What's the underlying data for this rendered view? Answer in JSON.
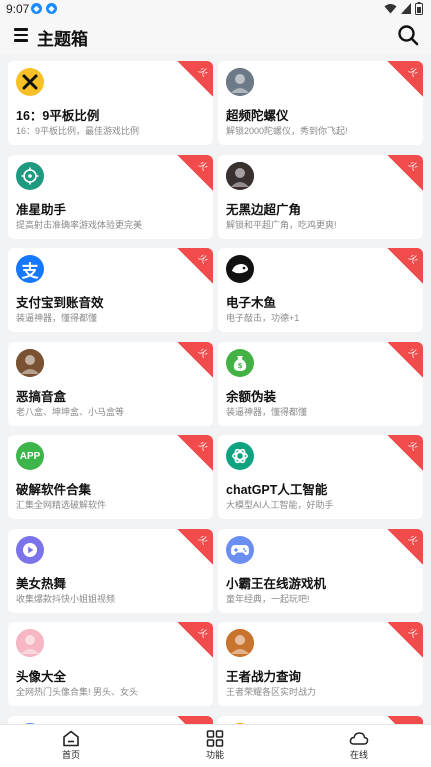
{
  "status": {
    "time": "9:07"
  },
  "header": {
    "title": "主题箱"
  },
  "cards": [
    {
      "name": "16：9平板比例",
      "desc": "16：9平板比例，最佳游戏比例",
      "icon": "hammer-icon",
      "badge": "火",
      "color": "#f6c026"
    },
    {
      "name": "超频陀螺仪",
      "desc": "解锁2000陀螺仪，秀到你飞起!",
      "icon": "player-avatar-icon",
      "badge": "火",
      "color": "#6b7a86"
    },
    {
      "name": "准星助手",
      "desc": "提高射击准确率游戏体验更完美",
      "icon": "crosshair-icon",
      "badge": "火",
      "color": "#1d9a7f"
    },
    {
      "name": "无黑边超广角",
      "desc": "解锁和平超广角，吃鸡更爽!",
      "icon": "helmet-avatar-icon",
      "badge": "火",
      "color": "#3a3030"
    },
    {
      "name": "支付宝到账音效",
      "desc": "装逼神器，懂得都懂",
      "icon": "alipay-icon",
      "badge": "火",
      "color": "#1677ff"
    },
    {
      "name": "电子木鱼",
      "desc": "电子敲击，功德+1",
      "icon": "wooden-fish-icon",
      "badge": "火",
      "color": "#111111"
    },
    {
      "name": "恶搞音盒",
      "desc": "老八盒、坤坤盒、小马盒等",
      "icon": "man-avatar-icon",
      "badge": "火",
      "color": "#7a5233"
    },
    {
      "name": "余额伪装",
      "desc": "装逼神器，懂得都懂",
      "icon": "money-bag-icon",
      "badge": "火",
      "color": "#43b244"
    },
    {
      "name": "破解软件合集",
      "desc": "汇集全网精选破解软件",
      "icon": "app-icon",
      "badge": "火",
      "color": "#3cb54a",
      "icon_text": "APP"
    },
    {
      "name": "chatGPT人工智能",
      "desc": "大模型AI人工智能，好助手",
      "icon": "openai-icon",
      "badge": "火",
      "color": "#10a37f"
    },
    {
      "name": "美女热舞",
      "desc": "收集爆款抖快小姐姐视频",
      "icon": "play-icon",
      "badge": "火",
      "color": "#7b73ec"
    },
    {
      "name": "小霸王在线游戏机",
      "desc": "童年经典，一起玩吧!",
      "icon": "gamepad-icon",
      "badge": "火",
      "color": "#6b8ff0"
    },
    {
      "name": "头像大全",
      "desc": "全网热门头像合集! 男头、女头",
      "icon": "girl-avatar-icon",
      "badge": "火",
      "color": "#f6b6c4"
    },
    {
      "name": "王者战力查询",
      "desc": "王者荣耀各区实时战力",
      "icon": "hero-avatar-icon",
      "badge": "火",
      "color": "#c8742f"
    }
  ],
  "partial_colors": [
    "#5b8def",
    "#f39c12"
  ],
  "tabs": [
    {
      "label": "首页",
      "icon": "home-icon"
    },
    {
      "label": "功能",
      "icon": "grid-icon"
    },
    {
      "label": "在线",
      "icon": "cloud-icon"
    }
  ]
}
